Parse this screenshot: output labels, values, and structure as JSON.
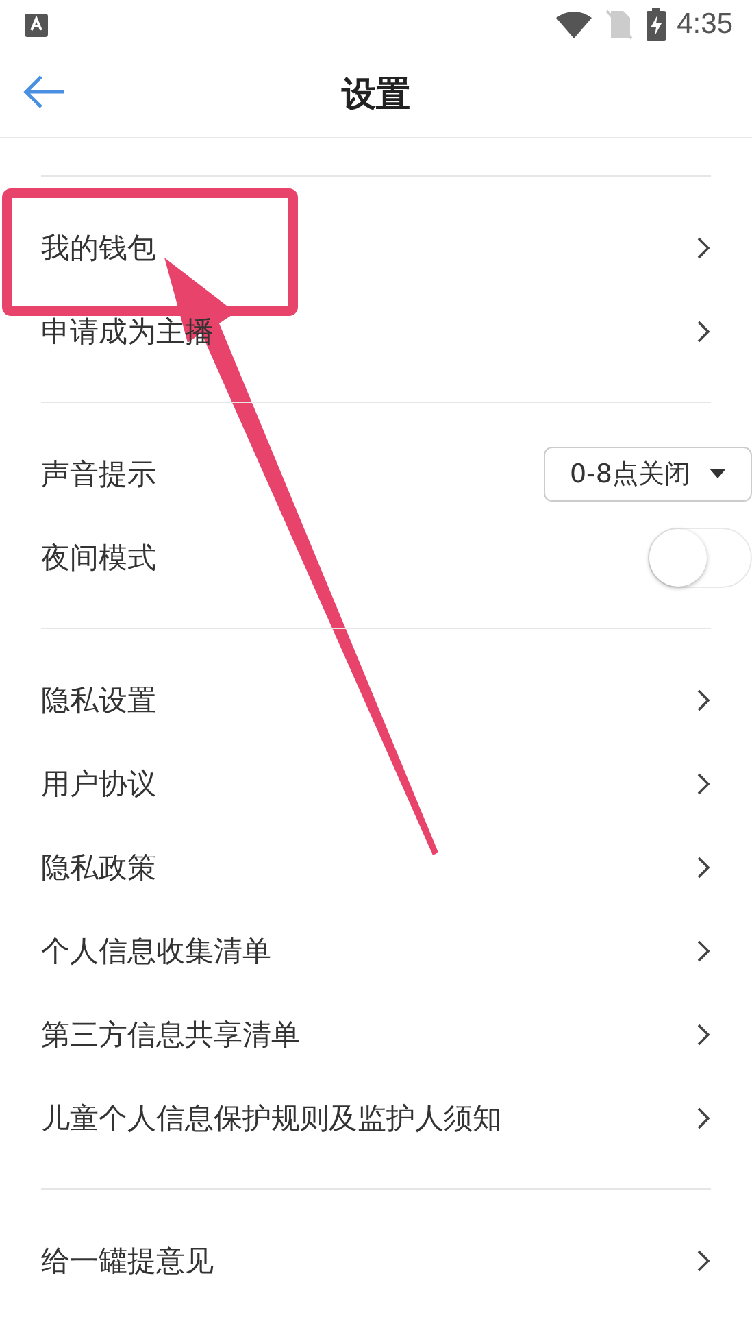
{
  "status_bar": {
    "time": "4:35"
  },
  "header": {
    "title": "设置"
  },
  "sections": [
    {
      "items": [
        {
          "kind": "link",
          "label": "我的钱包"
        },
        {
          "kind": "link",
          "label": "申请成为主播"
        }
      ]
    },
    {
      "items": [
        {
          "kind": "dropdown",
          "label": "声音提示",
          "value": "0-8点关闭"
        },
        {
          "kind": "toggle",
          "label": "夜间模式",
          "on": false
        }
      ]
    },
    {
      "items": [
        {
          "kind": "link",
          "label": "隐私设置"
        },
        {
          "kind": "link",
          "label": "用户协议"
        },
        {
          "kind": "link",
          "label": "隐私政策"
        },
        {
          "kind": "link",
          "label": "个人信息收集清单"
        },
        {
          "kind": "link",
          "label": "第三方信息共享清单"
        },
        {
          "kind": "link",
          "label": "儿童个人信息保护规则及监护人须知"
        }
      ]
    },
    {
      "items": [
        {
          "kind": "link",
          "label": "给一罐提意见"
        }
      ]
    }
  ]
}
